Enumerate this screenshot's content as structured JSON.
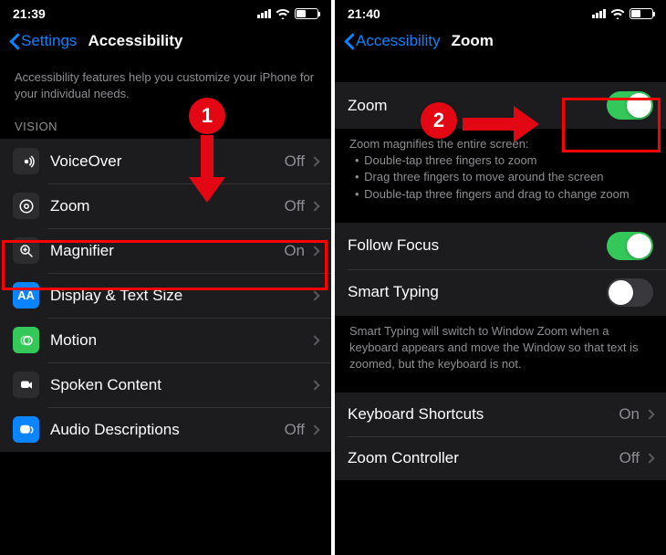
{
  "left": {
    "time": "21:39",
    "back_label": "Settings",
    "title": "Accessibility",
    "intro": "Accessibility features help you customize your iPhone for your individual needs.",
    "section_header": "VISION",
    "rows": [
      {
        "label": "VoiceOver",
        "value": "Off"
      },
      {
        "label": "Zoom",
        "value": "Off"
      },
      {
        "label": "Magnifier",
        "value": "On"
      },
      {
        "label": "Display & Text Size",
        "value": ""
      },
      {
        "label": "Motion",
        "value": ""
      },
      {
        "label": "Spoken Content",
        "value": ""
      },
      {
        "label": "Audio Descriptions",
        "value": "Off"
      }
    ],
    "badge": "1"
  },
  "right": {
    "time": "21:40",
    "back_label": "Accessibility",
    "title": "Zoom",
    "zoom_row_label": "Zoom",
    "zoom_on": true,
    "zoom_help_title": "Zoom magnifies the entire screen:",
    "zoom_help": [
      "Double-tap three fingers to zoom",
      "Drag three fingers to move around the screen",
      "Double-tap three fingers and drag to change zoom"
    ],
    "follow_focus_label": "Follow Focus",
    "follow_focus_on": true,
    "smart_typing_label": "Smart Typing",
    "smart_typing_on": false,
    "smart_typing_help": "Smart Typing will switch to Window Zoom when a keyboard appears and move the Window so that text is zoomed, but the keyboard is not.",
    "rows": [
      {
        "label": "Keyboard Shortcuts",
        "value": "On"
      },
      {
        "label": "Zoom Controller",
        "value": "Off"
      }
    ],
    "badge": "2"
  }
}
